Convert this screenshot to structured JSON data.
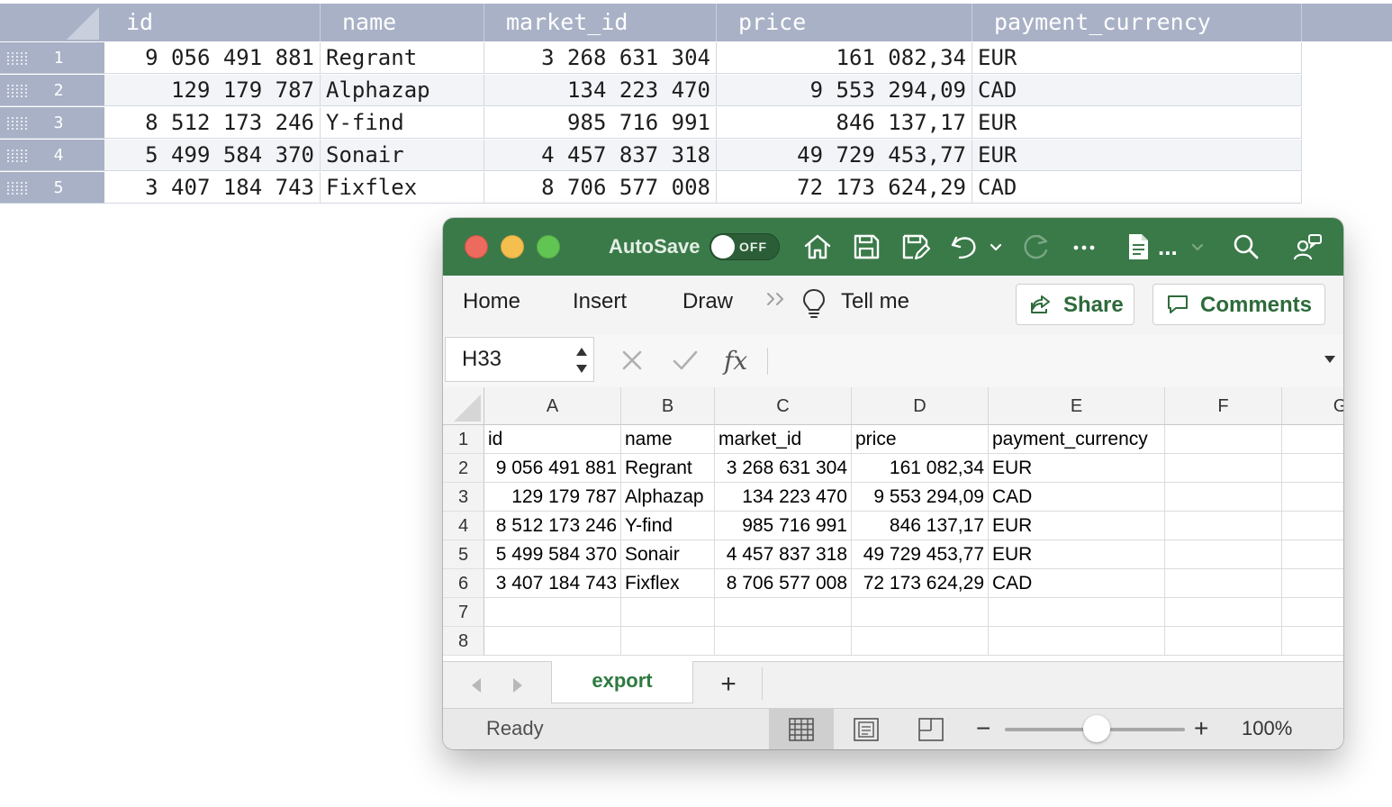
{
  "background_table": {
    "columns": [
      "id",
      "name",
      "market_id",
      "price",
      "payment_currency"
    ],
    "rows": [
      {
        "num": "1",
        "id": "9 056 491 881",
        "name": "Regrant",
        "market_id": "3 268 631 304",
        "price": "161 082,34",
        "payment_currency": "EUR"
      },
      {
        "num": "2",
        "id": "129 179 787",
        "name": "Alphazap",
        "market_id": "134 223 470",
        "price": "9 553 294,09",
        "payment_currency": "CAD"
      },
      {
        "num": "3",
        "id": "8 512 173 246",
        "name": "Y-find",
        "market_id": "985 716 991",
        "price": "846 137,17",
        "payment_currency": "EUR"
      },
      {
        "num": "4",
        "id": "5 499 584 370",
        "name": "Sonair",
        "market_id": "4 457 837 318",
        "price": "49 729 453,77",
        "payment_currency": "EUR"
      },
      {
        "num": "5",
        "id": "3 407 184 743",
        "name": "Fixflex",
        "market_id": "8 706 577 008",
        "price": "72 173 624,29",
        "payment_currency": "CAD"
      }
    ]
  },
  "excel": {
    "titlebar": {
      "autosave_label": "AutoSave",
      "autosave_state": "OFF",
      "doc_more": "...",
      "icons": [
        "home-icon",
        "save-icon",
        "save-as-icon",
        "undo-icon",
        "undo-dropdown-icon",
        "redo-icon",
        "more-icon",
        "document-icon",
        "search-icon",
        "share-people-icon"
      ]
    },
    "ribbon": {
      "tabs": [
        "Home",
        "Insert",
        "Draw"
      ],
      "tell_me": "Tell me",
      "share_label": "Share",
      "comments_label": "Comments"
    },
    "formula_bar": {
      "cell_ref": "H33",
      "fx": "fx",
      "formula": ""
    },
    "sheet": {
      "column_letters": [
        "A",
        "B",
        "C",
        "D",
        "E",
        "F",
        "G"
      ],
      "row_numbers": [
        "1",
        "2",
        "3",
        "4",
        "5",
        "6",
        "7",
        "8"
      ],
      "rows": [
        [
          "id",
          "name",
          "market_id",
          "price",
          "payment_currency"
        ],
        [
          "9 056 491 881",
          "Regrant",
          "3 268 631 304",
          "161 082,34",
          "EUR"
        ],
        [
          "129 179 787",
          "Alphazap",
          "134 223 470",
          "9 553 294,09",
          "CAD"
        ],
        [
          "8 512 173 246",
          "Y-find",
          "985 716 991",
          "846 137,17",
          "EUR"
        ],
        [
          "5 499 584 370",
          "Sonair",
          "4 457 837 318",
          "49 729 453,77",
          "EUR"
        ],
        [
          "3 407 184 743",
          "Fixflex",
          "8 706 577 008",
          "72 173 624,29",
          "CAD"
        ],
        [
          "",
          "",
          "",
          "",
          ""
        ],
        [
          "",
          "",
          "",
          "",
          ""
        ]
      ]
    },
    "tabs": {
      "active": "export",
      "add": "+"
    },
    "status": {
      "text": "Ready",
      "zoom_minus": "−",
      "zoom_plus": "+",
      "zoom_value": "100%",
      "zoom_level": 0.5
    },
    "colors": {
      "titlebar": "#3a7a49",
      "accent": "#2d7a40",
      "bg_header": "#a9b1c6"
    }
  }
}
